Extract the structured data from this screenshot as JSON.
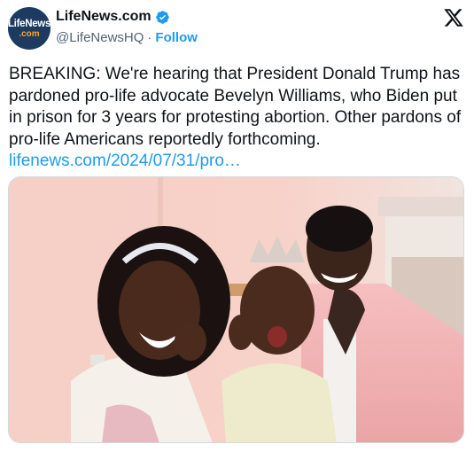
{
  "author": {
    "avatar_line1": "LifeNews",
    "avatar_line2": ".com",
    "display_name": "LifeNews.com",
    "handle": "@LifeNewsHQ",
    "follow_label": "Follow",
    "verified_color": "#1d9bf0"
  },
  "tweet": {
    "text": "BREAKING: We're hearing that President Donald Trump has pardoned pro-life advocate Bevelyn Williams, who Biden put in prison for 3 years for protesting abortion. Other pardons of pro-life Americans reportedly forthcoming.",
    "link": "lifenews.com/2024/07/31/pro…"
  },
  "icons": {
    "platform": "x-logo-icon",
    "verified": "verified-badge-icon"
  },
  "colors": {
    "link": "#1d9bf0",
    "text": "#0f1419",
    "secondary": "#536471"
  }
}
